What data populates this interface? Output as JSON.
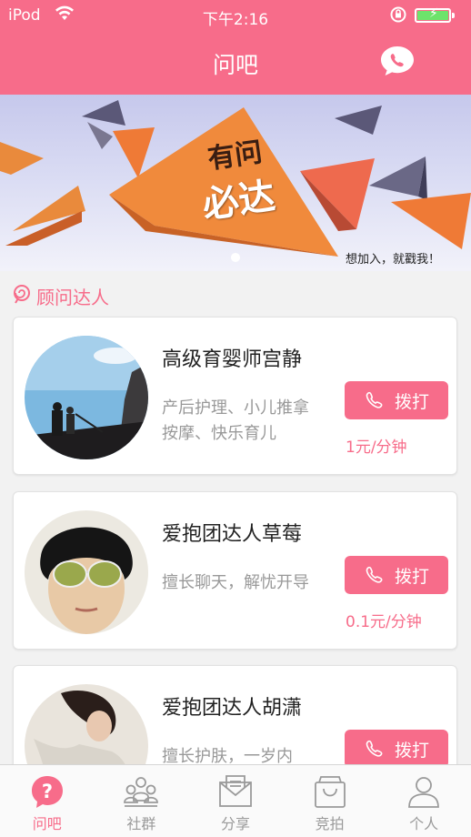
{
  "status_bar": {
    "device": "iPod",
    "time": "下午2:16"
  },
  "nav": {
    "title": "问吧",
    "chat_icon": "phone-chat-icon"
  },
  "banner": {
    "slogan_top": "有问",
    "slogan_bottom": "必达",
    "join_text": "想加入，就戳我！"
  },
  "section": {
    "title": "顾问达人",
    "icon": "lollipop-icon"
  },
  "consultants": [
    {
      "name": "高级育婴师宫静",
      "desc": "产后护理、小儿推拿按摩、快乐育儿",
      "call": "拨打",
      "price": "1元/分钟"
    },
    {
      "name": "爱抱团达人草莓",
      "desc": "擅长聊天，解忧开导",
      "call": "拨打",
      "price": "0.1元/分钟"
    },
    {
      "name": "爱抱团达人胡潇",
      "desc": "擅长护肤，一岁内",
      "call": "拨打",
      "price": ""
    }
  ],
  "tabs": [
    {
      "label": "问吧",
      "icon": "question-bubble-icon",
      "active": true
    },
    {
      "label": "社群",
      "icon": "group-icon",
      "active": false
    },
    {
      "label": "分享",
      "icon": "share-envelope-icon",
      "active": false
    },
    {
      "label": "竞拍",
      "icon": "shopping-bag-icon",
      "active": false
    },
    {
      "label": "个人",
      "icon": "person-icon",
      "active": false
    }
  ],
  "colors": {
    "accent": "#f76c8a",
    "battery": "#6de36b"
  }
}
